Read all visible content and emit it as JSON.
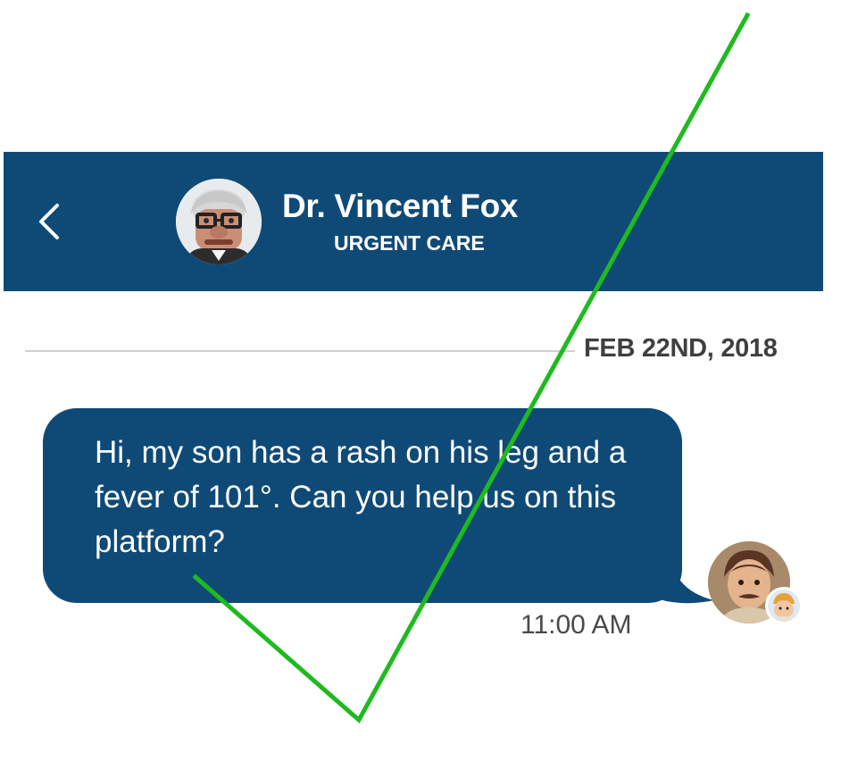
{
  "header": {
    "back_icon": "chevron-left-icon",
    "doctor_name": "Dr. Vincent Fox",
    "department": "URGENT CARE",
    "avatar_icon": "doctor-avatar",
    "background_color": "#0f4a77"
  },
  "conversation": {
    "date": "FEB 22ND, 2018",
    "messages": [
      {
        "text": "Hi, my son has a rash on his leg and a fever of 101°. Can you help us on this platform?",
        "time": "11:00 AM",
        "bubble_color": "#0f4a77",
        "sender_avatar_icon": "user-avatar",
        "secondary_avatar_icon": "child-avatar"
      }
    ]
  },
  "overlay": {
    "icon": "checkmark-icon",
    "color": "#1fba1f"
  }
}
